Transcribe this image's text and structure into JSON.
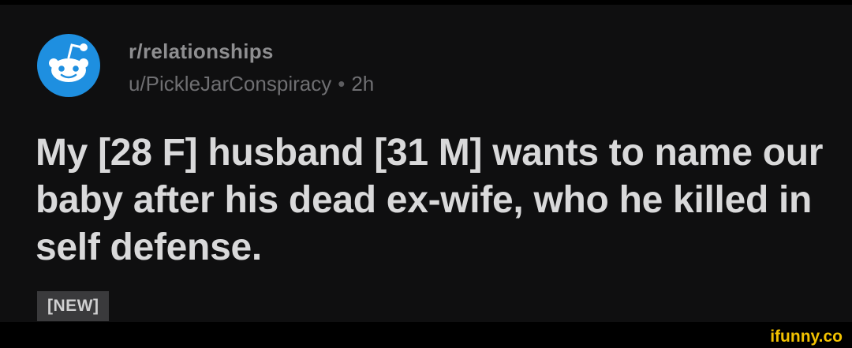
{
  "post": {
    "subreddit": "r/relationships",
    "username": "u/PickleJarConspiracy",
    "separator": "•",
    "age": "2h",
    "title": "My [28 F] husband [31 M] wants to name our baby after his dead ex-wife, who he killed in self defense.",
    "flair": "[NEW]"
  },
  "watermark": {
    "text": "ifunny.co"
  },
  "colors": {
    "background": "#0f0f10",
    "avatar_blue": "#1e8fe0",
    "title_text": "#d9d9da",
    "muted_text": "#8e8e90",
    "flair_bg": "#3a3a3c",
    "watermark": "#f2c200"
  },
  "icons": {
    "avatar": "reddit-snoo-icon"
  }
}
